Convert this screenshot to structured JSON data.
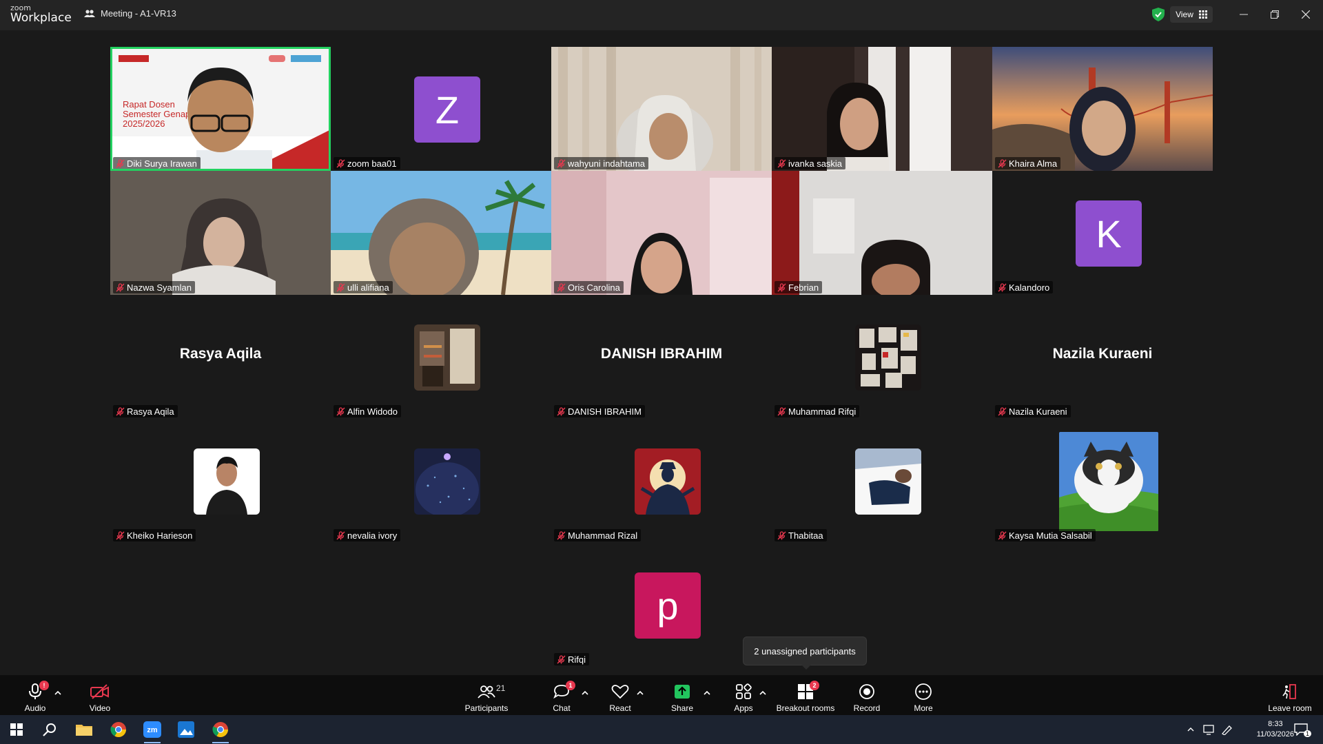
{
  "app": {
    "logo_top": "zoom",
    "logo_bottom": "Workplace",
    "meeting_title": "Meeting - A1-VR13",
    "view_label": "View"
  },
  "participants": [
    {
      "name": "Diki Surya Irawan",
      "kind": "video",
      "scene": "presenter",
      "active": true,
      "slide_title": "Rapat Dosen Semester Genap 2025/2026"
    },
    {
      "name": "zoom baa01",
      "kind": "letter",
      "letter": "Z",
      "color": "#8e4fcf"
    },
    {
      "name": "wahyuni indahtama",
      "kind": "video",
      "scene": "curtain-light"
    },
    {
      "name": "ivanka saskia",
      "kind": "video",
      "scene": "curtain-dark"
    },
    {
      "name": "Khaira Alma",
      "kind": "video",
      "scene": "bridge"
    },
    {
      "name": "Nazwa Syamlan",
      "kind": "video",
      "scene": "dark-room"
    },
    {
      "name": "ulli alifiana",
      "kind": "video",
      "scene": "beach"
    },
    {
      "name": "Oris Carolina",
      "kind": "video",
      "scene": "pink-room"
    },
    {
      "name": "Febrian",
      "kind": "video",
      "scene": "grey-room"
    },
    {
      "name": "Kalandoro",
      "kind": "letter",
      "letter": "K",
      "color": "#8e4fcf"
    },
    {
      "name": "Rasya Aqila",
      "kind": "text"
    },
    {
      "name": "Alfin Widodo",
      "kind": "image",
      "image": "room-photo"
    },
    {
      "name": "DANISH IBRAHIM",
      "kind": "text"
    },
    {
      "name": "Muhammad Rifqi",
      "kind": "image",
      "image": "poster-wall"
    },
    {
      "name": "Nazila Kuraeni",
      "kind": "text"
    },
    {
      "name": "Kheiko Harieson",
      "kind": "image",
      "image": "portrait-man"
    },
    {
      "name": "nevalia ivory",
      "kind": "image",
      "image": "night-dome"
    },
    {
      "name": "Muhammad Rizal",
      "kind": "image",
      "image": "samurai-moon"
    },
    {
      "name": "Thabitaa",
      "kind": "image",
      "image": "boat"
    },
    {
      "name": "Kaysa Mutia Salsabil",
      "kind": "image",
      "image": "cat-bliss",
      "large": true
    },
    {
      "name": "Rifqi",
      "kind": "letter",
      "letter": "p",
      "color": "#c8175d"
    }
  ],
  "tooltip": "2 unassigned participants",
  "toolbar": {
    "audio": {
      "label": "Audio",
      "badge": "!"
    },
    "video": {
      "label": "Video"
    },
    "participants": {
      "label": "Participants",
      "count": "21"
    },
    "chat": {
      "label": "Chat",
      "badge": "1"
    },
    "react": {
      "label": "React"
    },
    "share": {
      "label": "Share"
    },
    "apps": {
      "label": "Apps"
    },
    "breakout": {
      "label": "Breakout rooms",
      "badge": "2"
    },
    "record": {
      "label": "Record"
    },
    "more": {
      "label": "More"
    },
    "leave": {
      "label": "Leave room"
    }
  },
  "taskbar": {
    "time": "8:33",
    "date": "11/03/2026",
    "notif_count": "1"
  },
  "colors": {
    "accent_green": "#23d160",
    "badge_red": "#e8384f",
    "share_green": "#22c55e",
    "avatar_purple": "#8e4fcf",
    "avatar_pink": "#c8175d"
  }
}
